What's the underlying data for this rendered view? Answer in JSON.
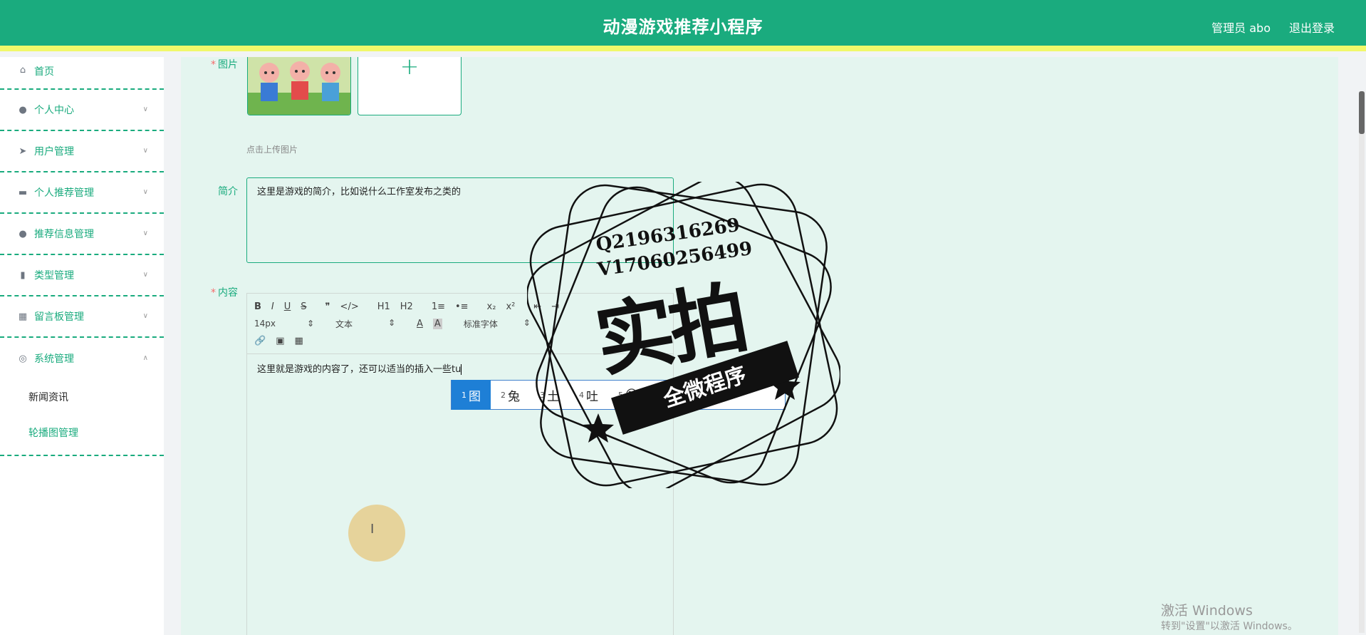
{
  "header": {
    "title": "动漫游戏推荐小程序",
    "user": "管理员 abo",
    "logout": "退出登录"
  },
  "sidebar": {
    "items": [
      {
        "label": "首页",
        "icon": "home-icon"
      },
      {
        "label": "个人中心",
        "icon": "user-icon"
      },
      {
        "label": "用户管理",
        "icon": "send-icon"
      },
      {
        "label": "个人推荐管理",
        "icon": "briefcase-icon"
      },
      {
        "label": "推荐信息管理",
        "icon": "user-icon"
      },
      {
        "label": "类型管理",
        "icon": "bar-chart-icon"
      },
      {
        "label": "留言板管理",
        "icon": "grid-icon"
      },
      {
        "label": "系统管理",
        "icon": "settings-icon"
      }
    ],
    "subitems": [
      "新闻资讯",
      "轮播图管理"
    ]
  },
  "form": {
    "image_label": "图片",
    "upload_hint": "点击上传图片",
    "intro_label": "简介",
    "intro_value": "这里是游戏的简介，比如说什么工作室发布之类的",
    "content_label": "内容",
    "content_value": "这里就是游戏的内容了，还可以适当的插入一些tu"
  },
  "editor": {
    "row1": [
      "B",
      "I",
      "U",
      "S",
      "❞",
      "</>",
      "H1",
      "H2",
      "1≡",
      "•≡",
      "x₂",
      "x²",
      "⇤",
      "⇥"
    ],
    "size_select": "14px",
    "text_select": "文本",
    "font_select": "标准字体",
    "color_button": "A",
    "bg_button": "A",
    "row3": [
      "🔗",
      "▣",
      "▦"
    ]
  },
  "ime": {
    "candidates": [
      {
        "index": "1",
        "text": "图"
      },
      {
        "index": "2",
        "text": "兔"
      },
      {
        "index": "3",
        "text": "土"
      },
      {
        "index": "4",
        "text": "吐"
      },
      {
        "index": "5",
        "text": "😊"
      }
    ]
  },
  "watermark": {
    "line1": "Q2196316269",
    "line2": "V17060256499",
    "big": "实拍",
    "ribbon": "全微程序"
  },
  "windows": {
    "title": "激活 Windows",
    "subtitle": "转到\"设置\"以激活 Windows。"
  }
}
